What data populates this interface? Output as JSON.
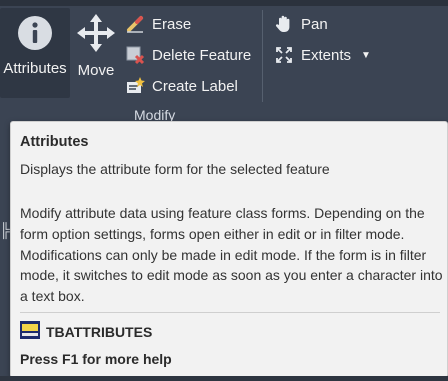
{
  "ribbon": {
    "attributes_label": "Attributes",
    "move_label": "Move",
    "erase_label": "Erase",
    "delete_feature_label": "Delete Feature",
    "create_label_label": "Create Label",
    "group_label": "Modify",
    "pan_label": "Pan",
    "extents_label": "Extents"
  },
  "tooltip": {
    "title": "Attributes",
    "summary": "Displays the attribute form for the selected feature",
    "body": "Modify attribute data using feature class forms. Depending on the form option settings, forms open either in edit or in filter mode. Modifications can only be made in edit mode. If the form is in filter mode, it switches to edit mode as soon as you enter a character into a text box.",
    "command": "TBATTRIBUTES",
    "help": "Press F1 for more help"
  },
  "colors": {
    "ribbon_bg": "#3b4453",
    "tooltip_bg": "#f2f2f2",
    "text_light": "#f2f2f2",
    "text_dark": "#2b2b2b"
  }
}
